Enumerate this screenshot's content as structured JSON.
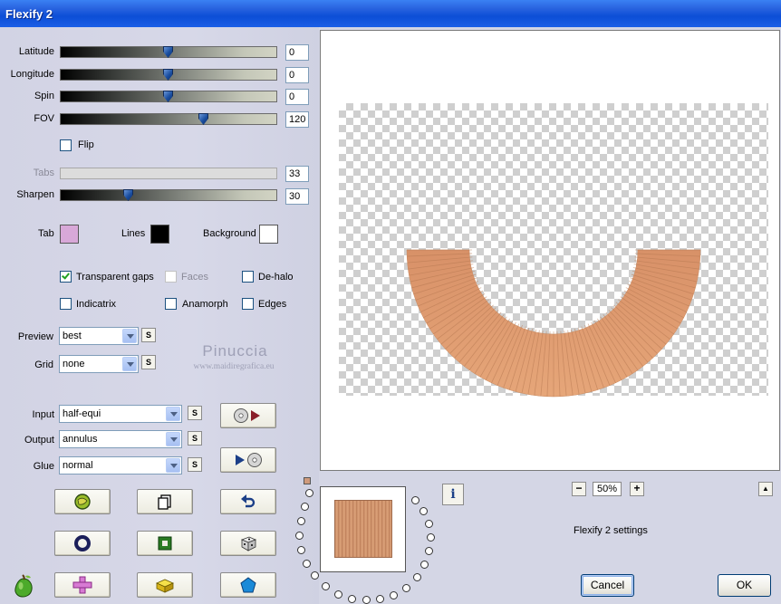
{
  "window": {
    "title": "Flexify 2"
  },
  "sliders": [
    {
      "label": "Latitude",
      "value": "0",
      "pos": 0.5
    },
    {
      "label": "Longitude",
      "value": "0",
      "pos": 0.5
    },
    {
      "label": "Spin",
      "value": "0",
      "pos": 0.5
    },
    {
      "label": "FOV",
      "value": "120",
      "pos": 0.67
    }
  ],
  "flip": {
    "label": "Flip",
    "checked": false
  },
  "tabs": {
    "label": "Tabs",
    "value": "33",
    "enabled": false
  },
  "sharpen": {
    "label": "Sharpen",
    "value": "30",
    "pos": 0.3
  },
  "colors": {
    "tab": {
      "label": "Tab",
      "color": "#d8a8d8"
    },
    "lines": {
      "label": "Lines",
      "color": "#000000"
    },
    "background": {
      "label": "Background",
      "color": "#ffffff"
    }
  },
  "options": {
    "transparent_gaps": {
      "label": "Transparent gaps",
      "checked": true
    },
    "faces": {
      "label": "Faces",
      "checked": false,
      "enabled": false
    },
    "dehalo": {
      "label": "De-halo",
      "checked": false
    },
    "indicatrix": {
      "label": "Indicatrix",
      "checked": false
    },
    "anamorph": {
      "label": "Anamorph",
      "checked": false
    },
    "edges": {
      "label": "Edges",
      "checked": false
    }
  },
  "preview": {
    "label": "Preview",
    "value": "best",
    "s_label": "S"
  },
  "grid": {
    "label": "Grid",
    "value": "none",
    "s_label": "S"
  },
  "input": {
    "label": "Input",
    "value": "half-equi",
    "s_label": "S"
  },
  "output": {
    "label": "Output",
    "value": "annulus",
    "s_label": "S"
  },
  "glue": {
    "label": "Glue",
    "value": "normal",
    "s_label": "S"
  },
  "watermark": {
    "name": "Pinuccia",
    "site": "www.maidiregrafica.eu"
  },
  "zoom": {
    "minus": "−",
    "value": "50%",
    "plus": "+"
  },
  "status_text": "Flexify 2 settings",
  "buttons": {
    "cancel": "Cancel",
    "ok": "OK",
    "info": "i"
  },
  "preview_colors": {
    "band_light": "#e6a679",
    "band_dark": "#b67851"
  }
}
